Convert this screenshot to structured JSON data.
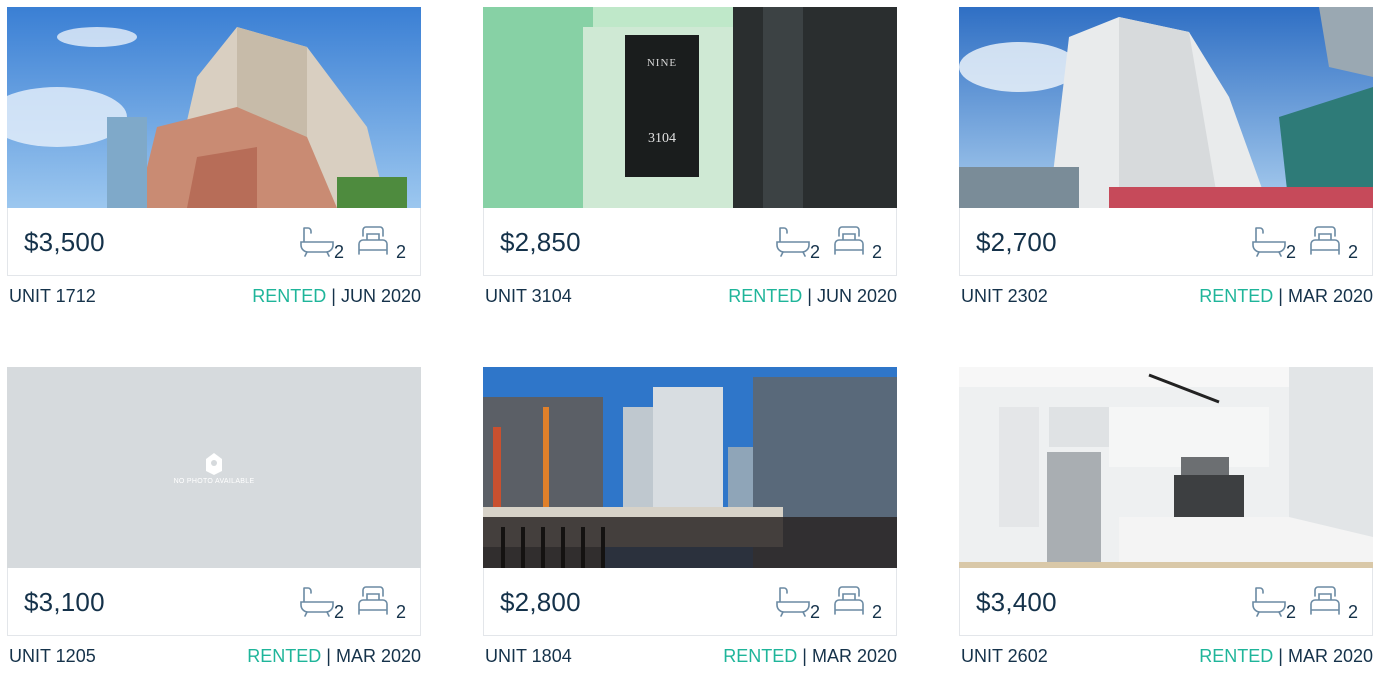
{
  "listings": [
    {
      "photo": "tower-exterior-brick",
      "price": "$3,500",
      "baths": "2",
      "beds": "2",
      "unit": "UNIT 1712",
      "status": "RENTED",
      "date": "JUN 2020"
    },
    {
      "photo": "unit-sign-3104",
      "price": "$2,850",
      "baths": "2",
      "beds": "2",
      "unit": "UNIT 3104",
      "status": "RENTED",
      "date": "JUN 2020",
      "sign_title": "NINE",
      "sign_number": "3104"
    },
    {
      "photo": "tower-exterior-white",
      "price": "$2,700",
      "baths": "2",
      "beds": "2",
      "unit": "UNIT 2302",
      "status": "RENTED",
      "date": "MAR 2020"
    },
    {
      "photo": "no-photo-placeholder",
      "price": "$3,100",
      "baths": "2",
      "beds": "2",
      "unit": "UNIT 1205",
      "status": "RENTED",
      "date": "MAR 2020",
      "placeholder_text": "NO PHOTO AVAILABLE"
    },
    {
      "photo": "balcony-city-view",
      "price": "$2,800",
      "baths": "2",
      "beds": "2",
      "unit": "UNIT 1804",
      "status": "RENTED",
      "date": "MAR 2020"
    },
    {
      "photo": "kitchen-interior",
      "price": "$3,400",
      "baths": "2",
      "beds": "2",
      "unit": "UNIT 2602",
      "status": "RENTED",
      "date": "MAR 2020"
    }
  ],
  "separator": "|",
  "icons": {
    "bath": "bathtub-icon",
    "bed": "bed-icon"
  },
  "colors": {
    "accent": "#1fb59a",
    "text": "#15324a",
    "border": "#e3e6ea"
  }
}
